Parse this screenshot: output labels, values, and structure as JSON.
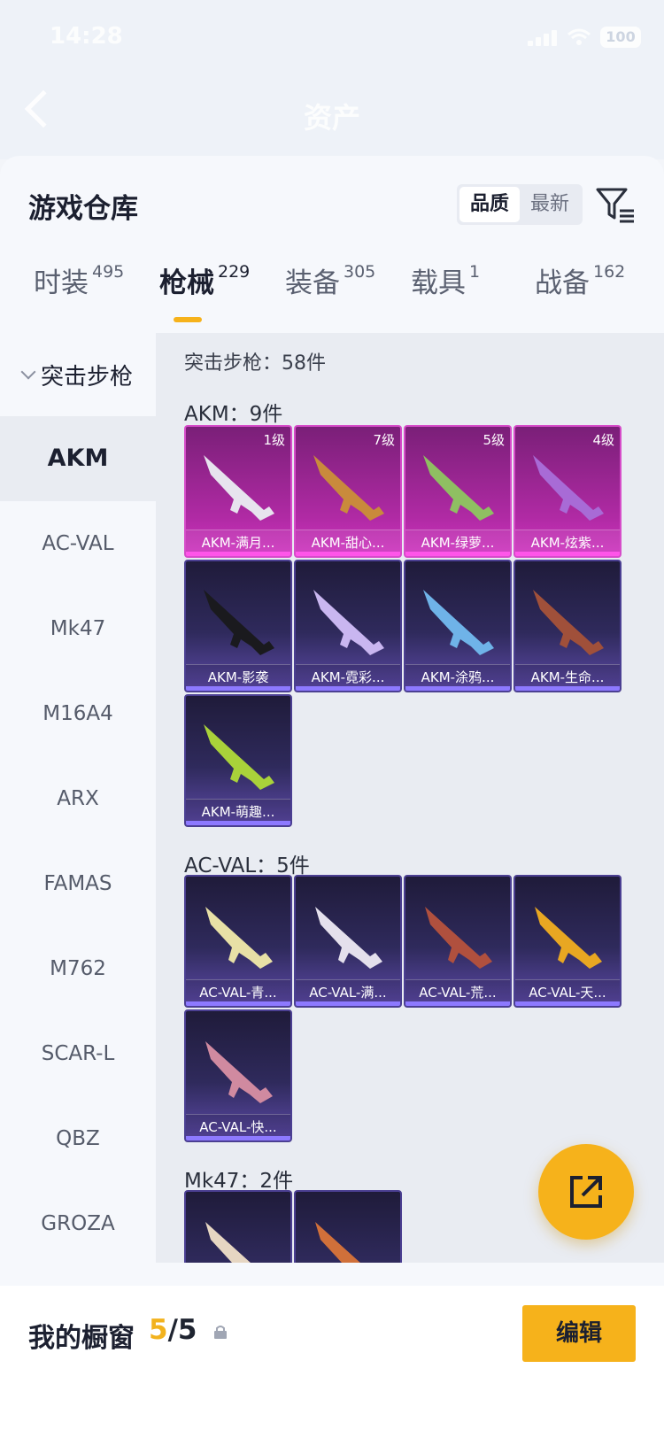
{
  "status_bar": {
    "time": "14:28",
    "battery": "100"
  },
  "nav": {
    "title": "资产"
  },
  "panel": {
    "title": "游戏仓库",
    "sort": {
      "options": [
        "品质",
        "最新"
      ],
      "selected": "品质"
    }
  },
  "tabs": [
    {
      "label": "时装",
      "count": "495",
      "active": false
    },
    {
      "label": "枪械",
      "count": "229",
      "active": true
    },
    {
      "label": "装备",
      "count": "305",
      "active": false
    },
    {
      "label": "载具",
      "count": "1",
      "active": false
    },
    {
      "label": "战备",
      "count": "162",
      "active": false
    }
  ],
  "sidebar": {
    "category": "突击步枪",
    "items": [
      "AKM",
      "AC-VAL",
      "Mk47",
      "M16A4",
      "ARX",
      "FAMAS",
      "M762",
      "SCAR-L",
      "QBZ",
      "GROZA"
    ],
    "active": "AKM"
  },
  "content": {
    "category_title": "突击步枪：58件",
    "groups": [
      {
        "title": "AKM：9件",
        "items": [
          {
            "name": "AKM-满月...",
            "level": "1级",
            "rarity": "pink"
          },
          {
            "name": "AKM-甜心...",
            "level": "7级",
            "rarity": "pink"
          },
          {
            "name": "AKM-绿萝...",
            "level": "5级",
            "rarity": "pink"
          },
          {
            "name": "AKM-炫紫...",
            "level": "4级",
            "rarity": "pink"
          },
          {
            "name": "AKM-影袭",
            "level": "",
            "rarity": "purple"
          },
          {
            "name": "AKM-霓彩...",
            "level": "",
            "rarity": "purple"
          },
          {
            "name": "AKM-涂鸦...",
            "level": "",
            "rarity": "purple"
          },
          {
            "name": "AKM-生命...",
            "level": "",
            "rarity": "purple"
          },
          {
            "name": "AKM-萌趣...",
            "level": "",
            "rarity": "purple"
          }
        ]
      },
      {
        "title": "AC-VAL：5件",
        "items": [
          {
            "name": "AC-VAL-青...",
            "level": "",
            "rarity": "purple"
          },
          {
            "name": "AC-VAL-满...",
            "level": "",
            "rarity": "purple"
          },
          {
            "name": "AC-VAL-荒...",
            "level": "",
            "rarity": "purple"
          },
          {
            "name": "AC-VAL-天...",
            "level": "",
            "rarity": "purple"
          },
          {
            "name": "AC-VAL-快...",
            "level": "",
            "rarity": "purple"
          }
        ]
      },
      {
        "title": "Mk47：2件",
        "items": []
      }
    ]
  },
  "bottom": {
    "title": "我的橱窗",
    "current": "5",
    "total": "/5",
    "edit_label": "编辑"
  },
  "colors": {
    "accent": "#f6b21b",
    "rarity_pink": "#b02aa4",
    "rarity_purple": "#2f2a5c"
  },
  "icons": [
    "back-icon",
    "filter-icon",
    "chevron-down-icon",
    "share-icon",
    "lock-icon",
    "signal-icon",
    "wifi-icon",
    "battery-icon"
  ]
}
